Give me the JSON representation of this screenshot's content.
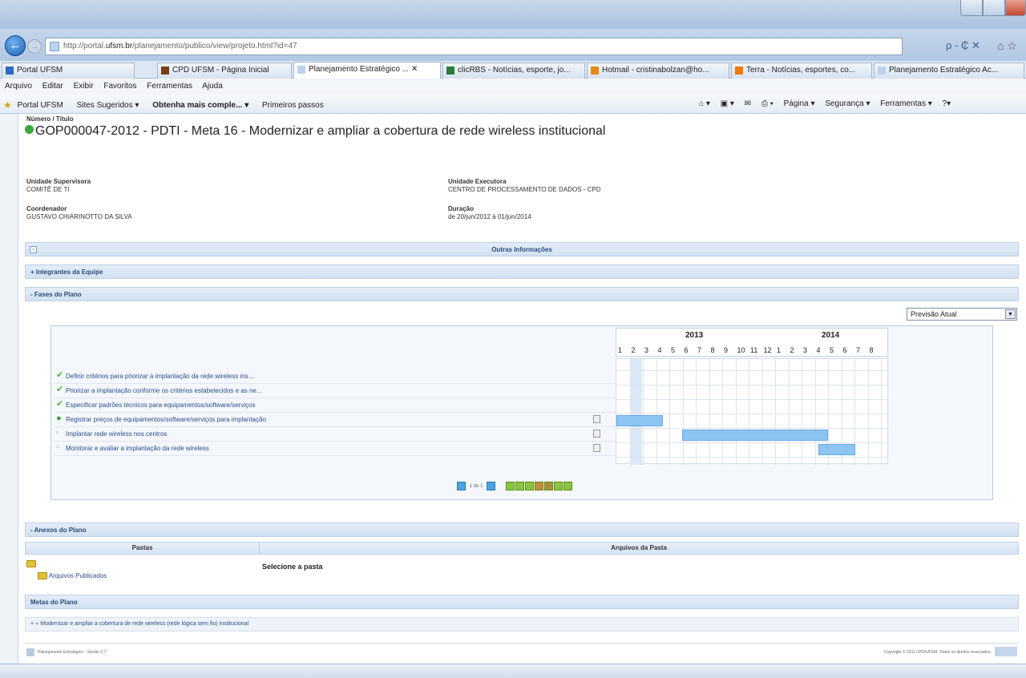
{
  "browser": {
    "url_prefix": "http://portal.",
    "url_domain": "ufsm.br",
    "url_rest": "/planejamento/publico/view/projeto.html?id=47",
    "search_label": "ρ - ₵ ✕",
    "tabs": [
      {
        "label": "Portal UFSM"
      },
      {
        "label": "CPD UFSM - Página Inicial"
      },
      {
        "label": "Planejamento Estratégico ... ✕"
      },
      {
        "label": "clicRBS - Notícias, esporte, jo..."
      },
      {
        "label": "Hotmail - cristinabolzan@ho..."
      },
      {
        "label": "Terra - Notícias, esportes, co..."
      },
      {
        "label": "Planejamento Estratégico Ac..."
      }
    ],
    "menu": [
      "Arquivo",
      "Editar",
      "Exibir",
      "Favoritos",
      "Ferramentas",
      "Ajuda"
    ],
    "favorites": [
      "Portal UFSM",
      "Sites Sugeridos ▾",
      "Obtenha mais comple... ▾",
      "Primeiros passos"
    ],
    "commands": [
      "Página ▾",
      "Segurança ▾",
      "Ferramentas ▾"
    ]
  },
  "project": {
    "title_label": "Número / Título",
    "title": "GOP000047-2012 - PDTI - Meta 16 - Modernizar e ampliar a cobertura de rede wireless institucional",
    "unidade_supervisora_label": "Unidade Supervisora",
    "unidade_supervisora": "COMITÊ DE TI",
    "unidade_executora_label": "Unidade Executora",
    "unidade_executora": "CENTRO DE PROCESSAMENTO DE DADOS - CPD",
    "coordenador_label": "Coordenador",
    "coordenador": "GUSTAVO CHIARINOTTO DA SILVA",
    "duracao_label": "Duração",
    "duracao": "de 20/jun/2012 à 01/jun/2014"
  },
  "sections": {
    "outras": "Outras Informações",
    "equipe": "Integrantes da Equipe",
    "fases": "Fases do Plano",
    "anexos": "Anexos do Plano",
    "metas": "Metas do Plano"
  },
  "fases": {
    "select_value": "Previsão Atual",
    "years": [
      "2013",
      "2014"
    ],
    "months": [
      "1",
      "2",
      "3",
      "4",
      "5",
      "6",
      "7",
      "8",
      "9",
      "10",
      "11",
      "12",
      "1",
      "2",
      "3",
      "4",
      "5",
      "6",
      "7",
      "8"
    ],
    "tasks": [
      {
        "label": "Definir critérios para priorizar a implantação da rede wireless ins...",
        "status": "done"
      },
      {
        "label": "Priorizar a implantação conforme os critérios estabelecidos e as ne...",
        "status": "done"
      },
      {
        "label": "Especificar padrões técnicos para equipamentos/software/serviços",
        "status": "done"
      },
      {
        "label": "Registrar preços de equipamentos/software/serviços para implantação",
        "status": "active"
      },
      {
        "label": "Implantar rede wireless nos centros",
        "status": "pending"
      },
      {
        "label": "Monitorar e avaliar a implantação da rede wireless",
        "status": "pending"
      }
    ],
    "pagination_text": "1 de 1"
  },
  "anexos": {
    "col_pastas": "Pastas",
    "col_arquivos": "Arquivos da Pasta",
    "folder": "Arquivos Publicados",
    "select_msg": "Selecione a pasta"
  },
  "metas": {
    "item": "Modernizar e ampliar a cobertura de rede wireless (rede lógica sem fio) institucional"
  },
  "footer": {
    "left": "Planejamento Estratégico - Versão 3.7",
    "right": "Copyright © 2011 CPD/UFSM. Todos os direitos reservados."
  }
}
